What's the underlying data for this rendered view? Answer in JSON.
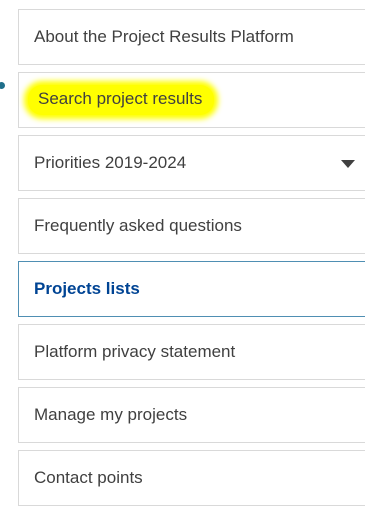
{
  "nav": {
    "items": [
      {
        "label": "About the Project Results Platform"
      },
      {
        "label": "Search project results"
      },
      {
        "label": "Priorities 2019-2024"
      },
      {
        "label": "Frequently asked questions"
      },
      {
        "label": "Projects lists"
      },
      {
        "label": "Platform privacy statement"
      },
      {
        "label": "Manage my projects"
      },
      {
        "label": "Contact points"
      }
    ],
    "active_item": "Projects lists",
    "highlighted_item": "Search project results",
    "dropdown_icon": "chevron-down-icon"
  },
  "colors": {
    "border": "#d9d9d9",
    "active_border": "#4f8fb3",
    "active_text": "#004494",
    "text": "#404040",
    "highlight": "#ffff00"
  }
}
